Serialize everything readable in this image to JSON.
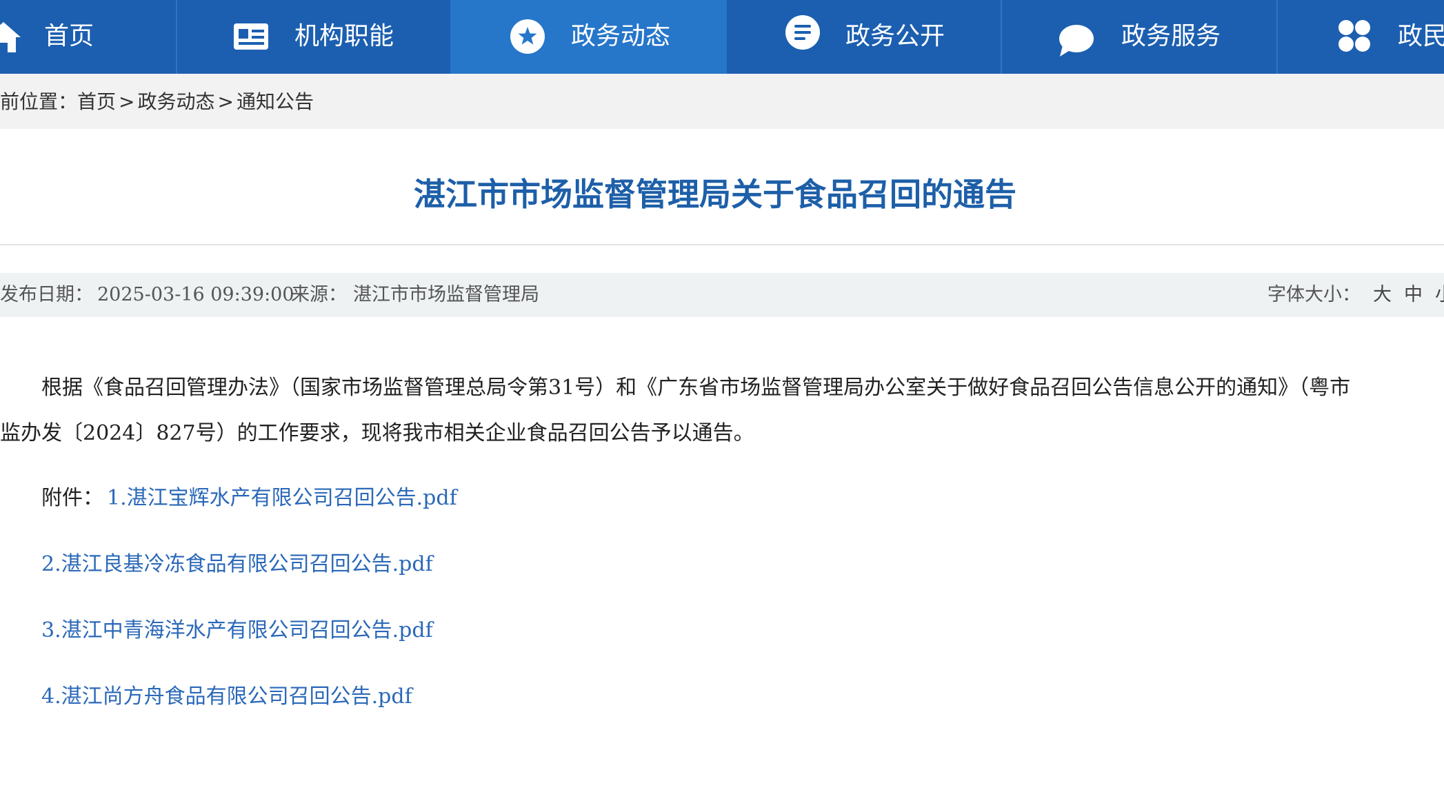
{
  "nav": {
    "items": [
      {
        "label": "首页",
        "icon": "home-icon"
      },
      {
        "label": "机构职能",
        "icon": "id-card-icon"
      },
      {
        "label": "政务动态",
        "icon": "star-badge-icon"
      },
      {
        "label": "政务公开",
        "icon": "document-list-icon"
      },
      {
        "label": "政务服务",
        "icon": "chat-bubble-icon"
      },
      {
        "label": "政民",
        "icon": "grid-four-icon"
      }
    ],
    "active_index": 2,
    "colors": {
      "background": "#1c5fb0",
      "active_background": "#2676ca",
      "text": "#ffffff"
    }
  },
  "breadcrumb": {
    "prefix": "前位置：",
    "items": [
      "首页",
      "政务动态",
      "通知公告"
    ],
    "separator": ">"
  },
  "article": {
    "title": "湛江市市场监督管理局关于食品召回的通告",
    "meta": {
      "date_label": "发布日期：",
      "date_value": "2025-03-16 09:39:00",
      "source_label": "来源：",
      "source_value": "湛江市市场监督管理局",
      "font_size_label": "字体大小：",
      "font_size_options": [
        "大",
        "中",
        "小"
      ]
    },
    "body_lines": [
      "根据《食品召回管理办法》（国家市场监督管理总局令第31号）和《广东省市场监督管理局办公室关于做好食品召回公告信息公开的通知》（粤市",
      "监办发〔2024〕827号）的工作要求，现将我市相关企业食品召回公告予以通告。"
    ],
    "attachments_label": "附件：",
    "attachments": [
      "1.湛江宝辉水产有限公司召回公告.pdf",
      "2.湛江良基冷冻食品有限公司召回公告.pdf",
      "3.湛江中青海洋水产有限公司召回公告.pdf",
      "4.湛江尚方舟食品有限公司召回公告.pdf"
    ],
    "colors": {
      "title": "#1d5fa8",
      "link": "#2a68b8"
    }
  }
}
